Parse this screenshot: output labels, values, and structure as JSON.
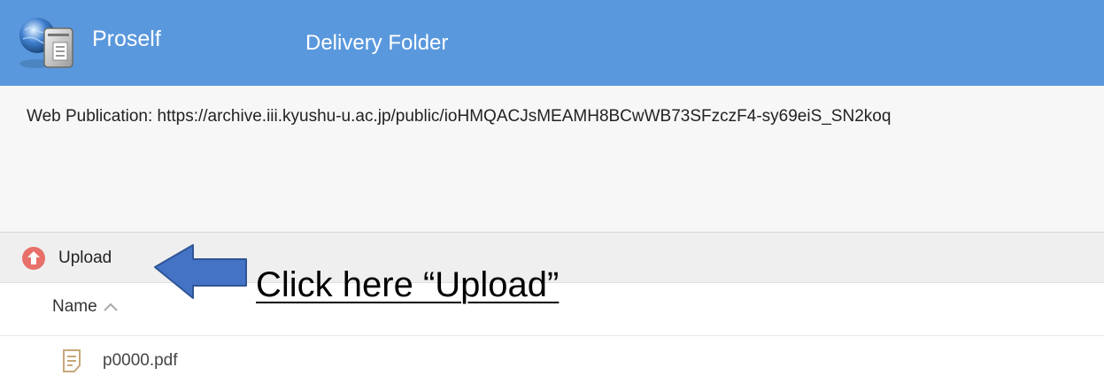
{
  "header": {
    "app_name": "Proself",
    "title": "Delivery Folder",
    "background_color": "#5a98dd",
    "logo_icon": "globe-server-icon"
  },
  "info": {
    "publication": "Web Publication: https://archive.iii.kyushu-u.ac.jp/public/ioHMQACJsMEAMH8BCwWB73SFzczF4-sy69eiS_SN2koq"
  },
  "toolbar": {
    "upload_label": "Upload",
    "upload_icon": "upload-arrow-circle-icon",
    "upload_icon_color": "#e8706a"
  },
  "table": {
    "columns": [
      {
        "label": "Name",
        "sort": "ascending"
      }
    ],
    "rows": [
      {
        "name": "p0000.pdf",
        "icon": "document-icon"
      }
    ]
  },
  "annotation": {
    "text": "Click here “Upload”",
    "arrow_color": "#4472c4",
    "arrow_icon": "left-arrow-icon"
  }
}
